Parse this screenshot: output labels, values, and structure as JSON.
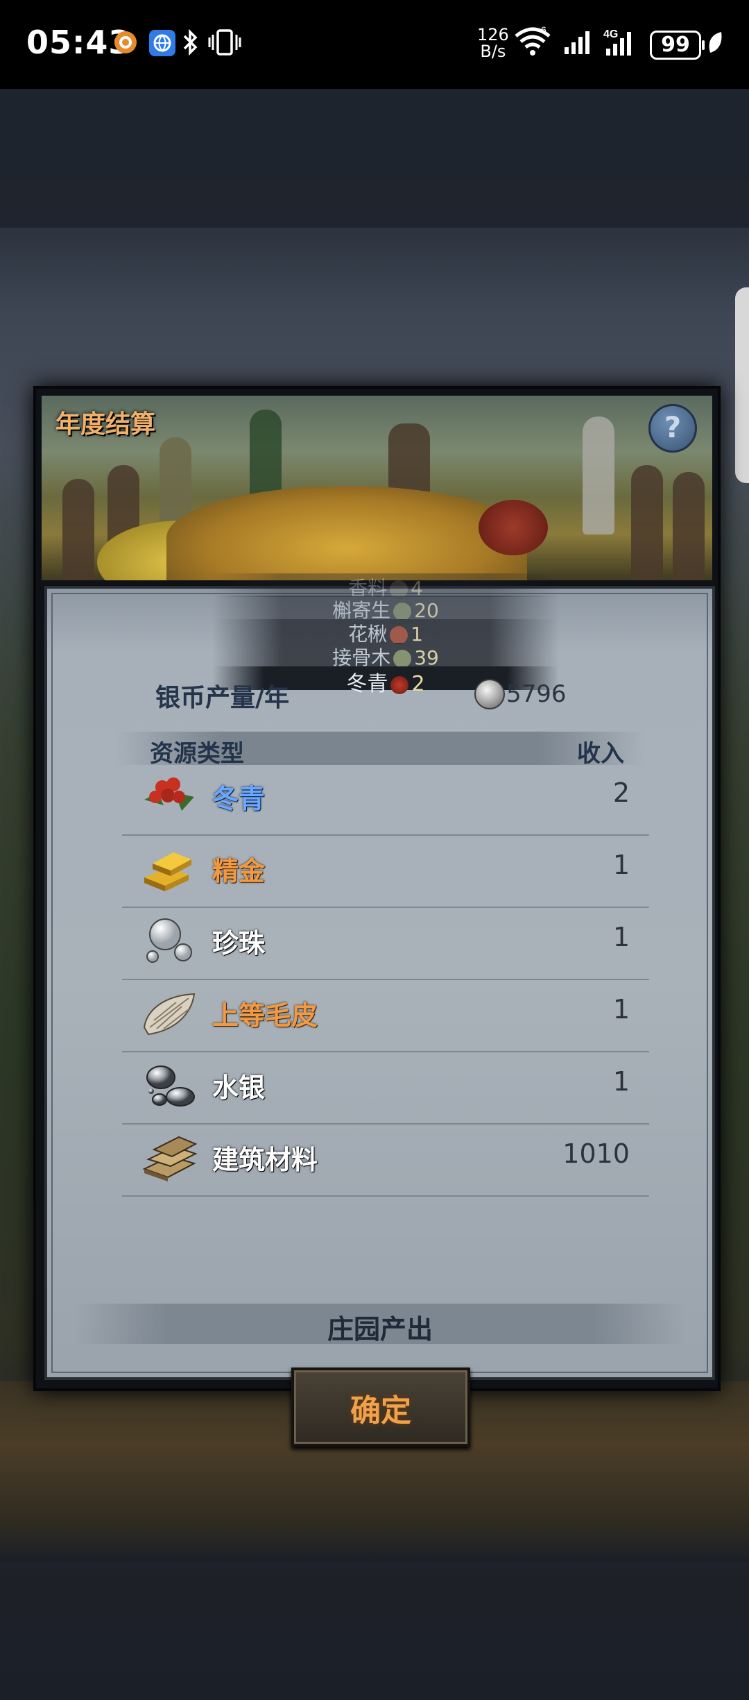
{
  "status_bar": {
    "time": "05:43",
    "net_speed_value": "126",
    "net_speed_unit": "B/s",
    "battery": "99",
    "icons": [
      "sun-icon",
      "browser-icon",
      "bluetooth-icon",
      "vibrate-icon",
      "wifi-icon",
      "signal-icon",
      "signal-4g-icon",
      "battery-icon",
      "leaf-icon"
    ]
  },
  "dialog": {
    "title": "年度结算",
    "help_glyph": "?",
    "picker": [
      {
        "name": "香料",
        "qty": "4"
      },
      {
        "name": "槲寄生",
        "qty": "20"
      },
      {
        "name": "花楸",
        "qty": "1"
      },
      {
        "name": "接骨木",
        "qty": "39"
      },
      {
        "name": "冬青",
        "qty": "2"
      }
    ],
    "silver": {
      "label": "银币产量/年",
      "value": "5796"
    },
    "table": {
      "header_type": "资源类型",
      "header_income": "收入",
      "rows": [
        {
          "name": "冬青",
          "value": "2",
          "icon": "holly-berry-icon"
        },
        {
          "name": "精金",
          "value": "1",
          "icon": "gold-bar-icon"
        },
        {
          "name": "珍珠",
          "value": "1",
          "icon": "pearl-icon"
        },
        {
          "name": "上等毛皮",
          "value": "1",
          "icon": "fur-icon"
        },
        {
          "name": "水银",
          "value": "1",
          "icon": "mercury-icon"
        },
        {
          "name": "建筑材料",
          "value": "1010",
          "icon": "building-material-icon"
        }
      ]
    },
    "section_title": "庄园产出",
    "confirm_label": "确定"
  }
}
